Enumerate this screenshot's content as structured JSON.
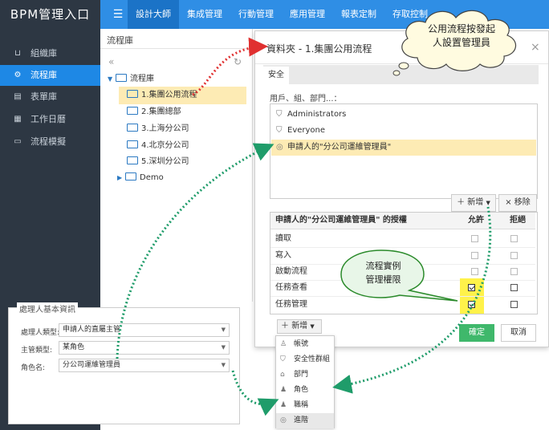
{
  "app": {
    "title": "BPM管理入口"
  },
  "topnav": {
    "items": [
      "設計大師",
      "集成管理",
      "行動管理",
      "應用管理",
      "報表定制",
      "存取控制"
    ]
  },
  "sidebar": {
    "items": [
      {
        "label": "組織庫",
        "icon": "org-icon"
      },
      {
        "label": "流程庫",
        "icon": "flow-icon"
      },
      {
        "label": "表單庫",
        "icon": "table-icon"
      },
      {
        "label": "工作日曆",
        "icon": "calendar-icon"
      },
      {
        "label": "流程模擬",
        "icon": "monitor-icon"
      }
    ]
  },
  "tree": {
    "title": "流程庫",
    "root": "流程庫",
    "nodes": [
      "1.集團公用流程",
      "2.集團總部",
      "3.上海分公司",
      "4.北京分公司",
      "5.深圳分公司",
      "Demo"
    ]
  },
  "dialog": {
    "title": "資料夾 - 1.集團公用流程",
    "tab": "安全",
    "users_label": "用戶、組、部門...：",
    "users": [
      "Administrators",
      "Everyone",
      "申請人的\"分公司運維管理員\""
    ],
    "add_label": "新增",
    "remove_label": "移除",
    "perm_header": "申請人的\"分公司運維管理員\" 的授權",
    "allow_label": "允許",
    "deny_label": "拒絕",
    "permissions": [
      {
        "name": "讀取",
        "allow": false,
        "deny": false
      },
      {
        "name": "寫入",
        "allow": false,
        "deny": false
      },
      {
        "name": "啟動流程",
        "allow": false,
        "deny": false
      },
      {
        "name": "任務查看",
        "allow": true,
        "deny": false
      },
      {
        "name": "任務管理",
        "allow": true,
        "deny": false
      }
    ],
    "ok_label": "確定",
    "cancel_label": "取消"
  },
  "new_menu": {
    "button_label": "新增",
    "items": [
      {
        "label": "帳號",
        "icon": "user-icon"
      },
      {
        "label": "安全性群組",
        "icon": "shield-icon"
      },
      {
        "label": "部門",
        "icon": "house-icon"
      },
      {
        "label": "角色",
        "icon": "role-icon"
      },
      {
        "label": "職稱",
        "icon": "title-icon"
      },
      {
        "label": "進階",
        "icon": "globe-icon"
      }
    ]
  },
  "info_panel": {
    "title": "處理人基本資訊",
    "fields": [
      {
        "label": "處理人類型:",
        "value": "申請人的直屬主管"
      },
      {
        "label": "主管類型:",
        "value": "某角色"
      },
      {
        "label": "角色名:",
        "value": "分公司運維管理員"
      }
    ]
  },
  "annotations": {
    "cloud_text": [
      "公用流程按發起",
      "人設置管理員"
    ],
    "bubble_text": [
      "流程實例",
      "管理權限"
    ]
  },
  "colors": {
    "accent": "#2f8ee5",
    "sidebar": "#2d3743",
    "highlight": "#fdebb4",
    "arrow_red": "#e03030",
    "arrow_green": "#1f9c6a"
  }
}
